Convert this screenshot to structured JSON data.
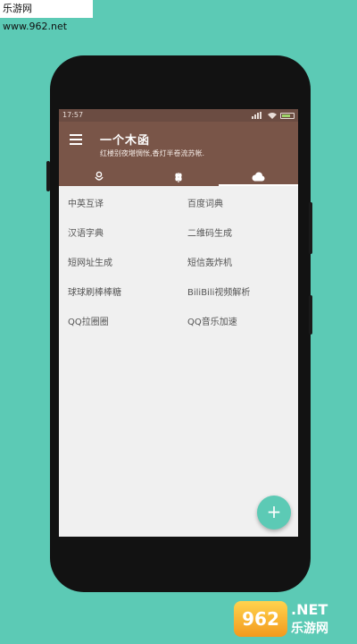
{
  "watermark": {
    "top_text": "乐游网 www.962.net",
    "badge": "962",
    "net": ".NET",
    "cn": "乐游网"
  },
  "statusbar": {
    "time": "17:57",
    "battery_level": 0.75
  },
  "appbar": {
    "title": "一个木函",
    "subtitle": "红楼别夜堪惆怅,香灯半卷流苏帐."
  },
  "tabs": [
    {
      "icon": "flower-icon",
      "active": false
    },
    {
      "icon": "wheat-icon",
      "active": false
    },
    {
      "icon": "cloud-icon",
      "active": true
    }
  ],
  "tools": [
    "中英互译",
    "百度词典",
    "汉语字典",
    "二维码生成",
    "短网址生成",
    "短信轰炸机",
    "球球刷棒棒糖",
    "BiliBili视频解析",
    "QQ拉圈圈",
    "QQ音乐加速"
  ],
  "fab": {
    "label": "+"
  },
  "colors": {
    "background": "#5ccab5",
    "appbar": "#795548",
    "statusbar": "#6b4c42",
    "fab": "#5ccab5"
  }
}
